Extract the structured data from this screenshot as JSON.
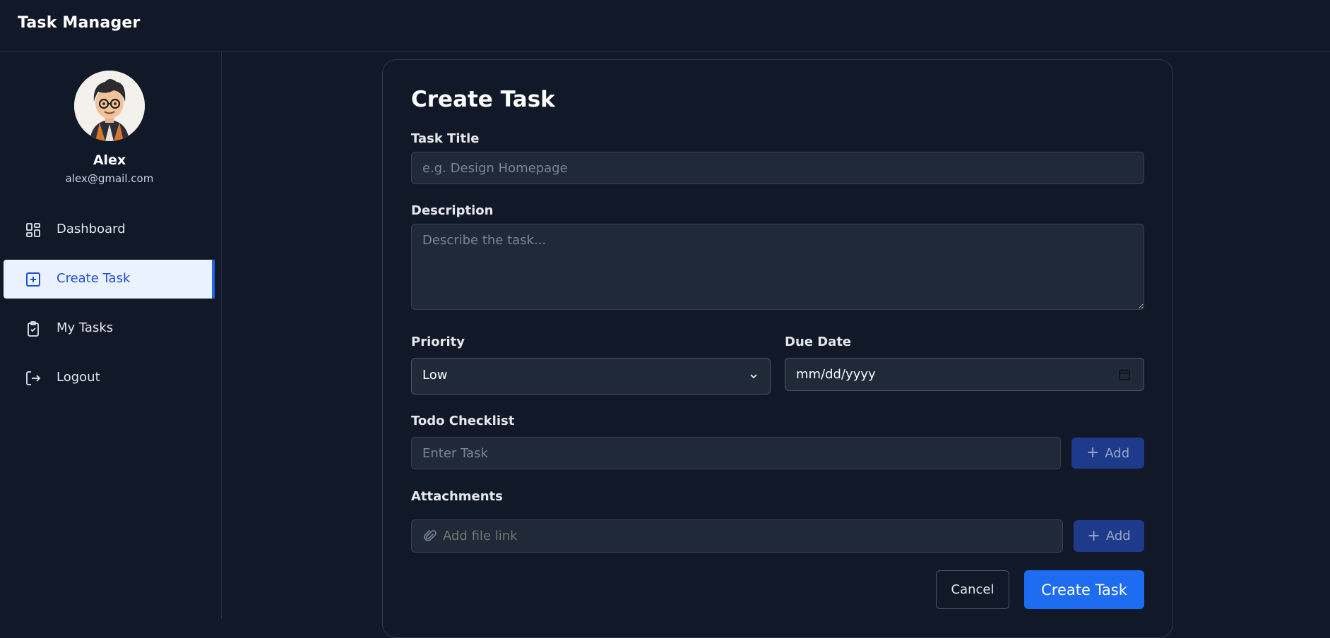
{
  "app": {
    "title": "Task Manager"
  },
  "user": {
    "name": "Alex",
    "email": "alex@gmail.com"
  },
  "sidebar": {
    "items": [
      {
        "label": "Dashboard",
        "icon": "dashboard-grid-icon"
      },
      {
        "label": "Create Task",
        "icon": "plus-square-icon",
        "active": true
      },
      {
        "label": "My Tasks",
        "icon": "clipboard-check-icon"
      },
      {
        "label": "Logout",
        "icon": "logout-icon"
      }
    ]
  },
  "form": {
    "heading": "Create Task",
    "title_label": "Task Title",
    "title_placeholder": "e.g. Design Homepage",
    "description_label": "Description",
    "description_placeholder": "Describe the task...",
    "priority_label": "Priority",
    "priority_value": "Low",
    "due_date_label": "Due Date",
    "due_date_placeholder": "mm/dd/yyyy",
    "checklist_label": "Todo Checklist",
    "checklist_placeholder": "Enter Task",
    "checklist_add": "Add",
    "attachments_label": "Attachments",
    "attachment_placeholder": "Add file link",
    "attachment_add": "Add",
    "cancel_label": "Cancel",
    "submit_label": "Create Task"
  },
  "colors": {
    "background": "#111827",
    "accent": "#1d6cf2",
    "active_nav_bg": "#eaf2ff",
    "active_nav_text": "#1d4ed8"
  }
}
